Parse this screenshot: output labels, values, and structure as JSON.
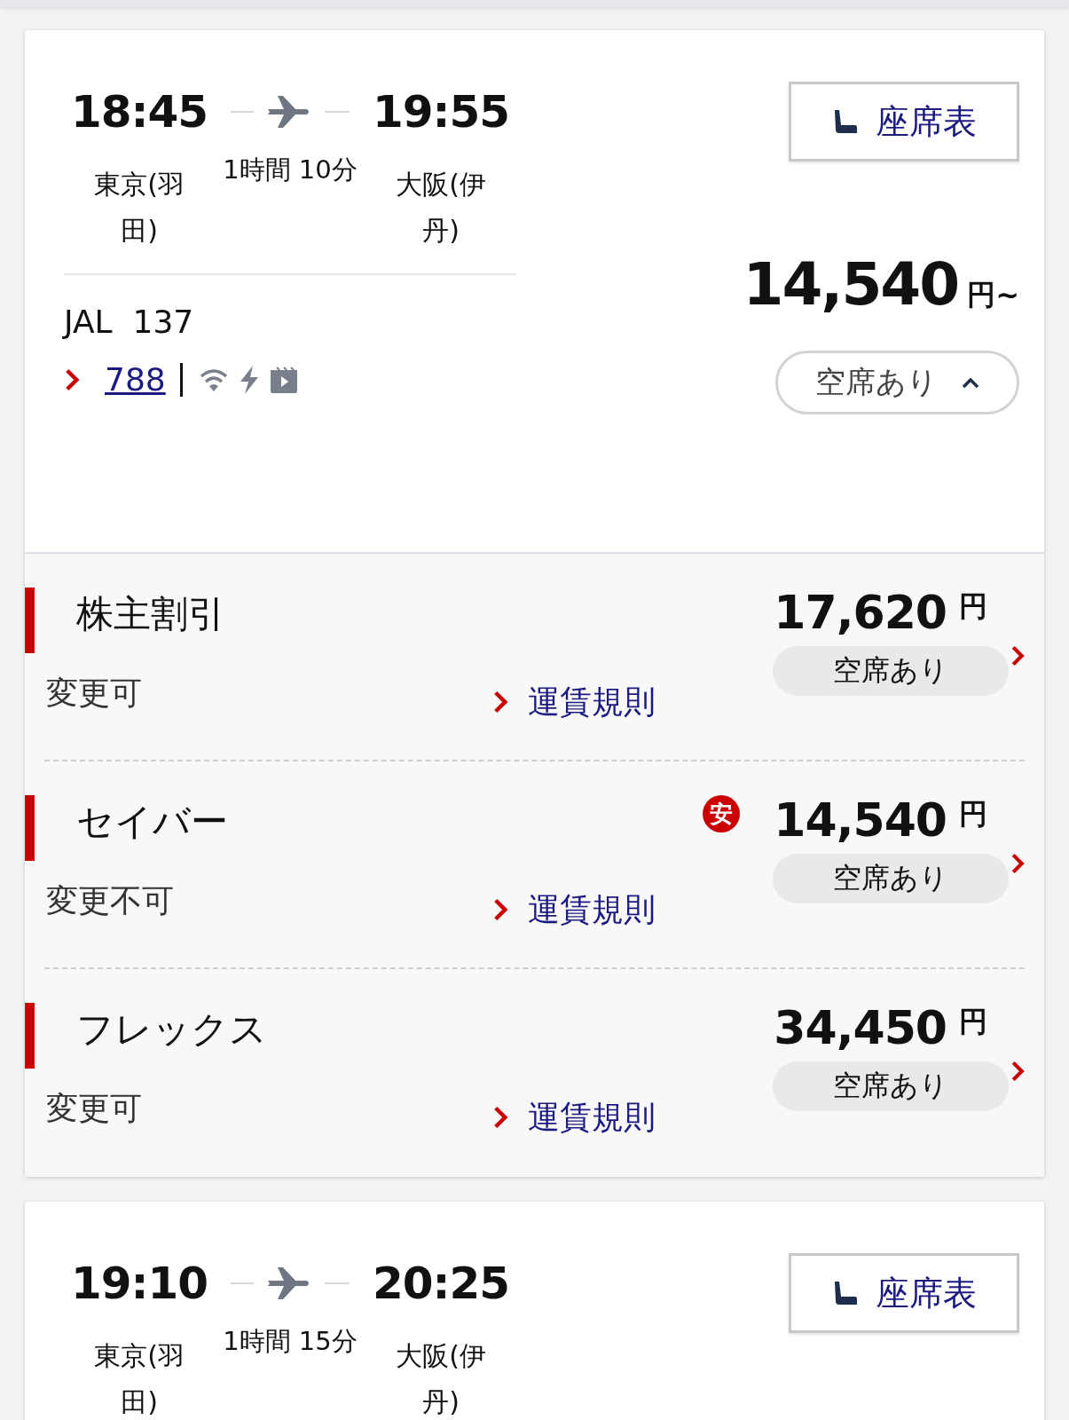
{
  "flights": [
    {
      "departure_time": "18:45",
      "arrival_time": "19:55",
      "departure_airport": "東京(羽田)",
      "arrival_airport": "大阪(伊丹)",
      "duration": "1時間 10分",
      "seat_map_button": "座席表",
      "flight_number": "JAL  137",
      "aircraft": "788",
      "lowest_price": "14,540",
      "price_unit": "円~",
      "availability": {
        "label": "空席あり",
        "expanded": true
      },
      "fares": [
        {
          "name": "株主割引",
          "change_rule": "変更可",
          "rules_link": "運賃規則",
          "price": "17,620",
          "unit": "円",
          "availability": "空席あり"
        },
        {
          "name": "セイバー",
          "change_rule": "変更不可",
          "rules_link": "運賃規則",
          "badge": "安",
          "price": "14,540",
          "unit": "円",
          "availability": "空席あり"
        },
        {
          "name": "フレックス",
          "change_rule": "変更可",
          "rules_link": "運賃規則",
          "price": "34,450",
          "unit": "円",
          "availability": "空席あり"
        }
      ]
    },
    {
      "departure_time": "19:10",
      "arrival_time": "20:25",
      "departure_airport": "東京(羽田)",
      "arrival_airport": "大阪(伊丹)",
      "duration": "1時間 15分",
      "seat_map_button": "座席表"
    }
  ]
}
